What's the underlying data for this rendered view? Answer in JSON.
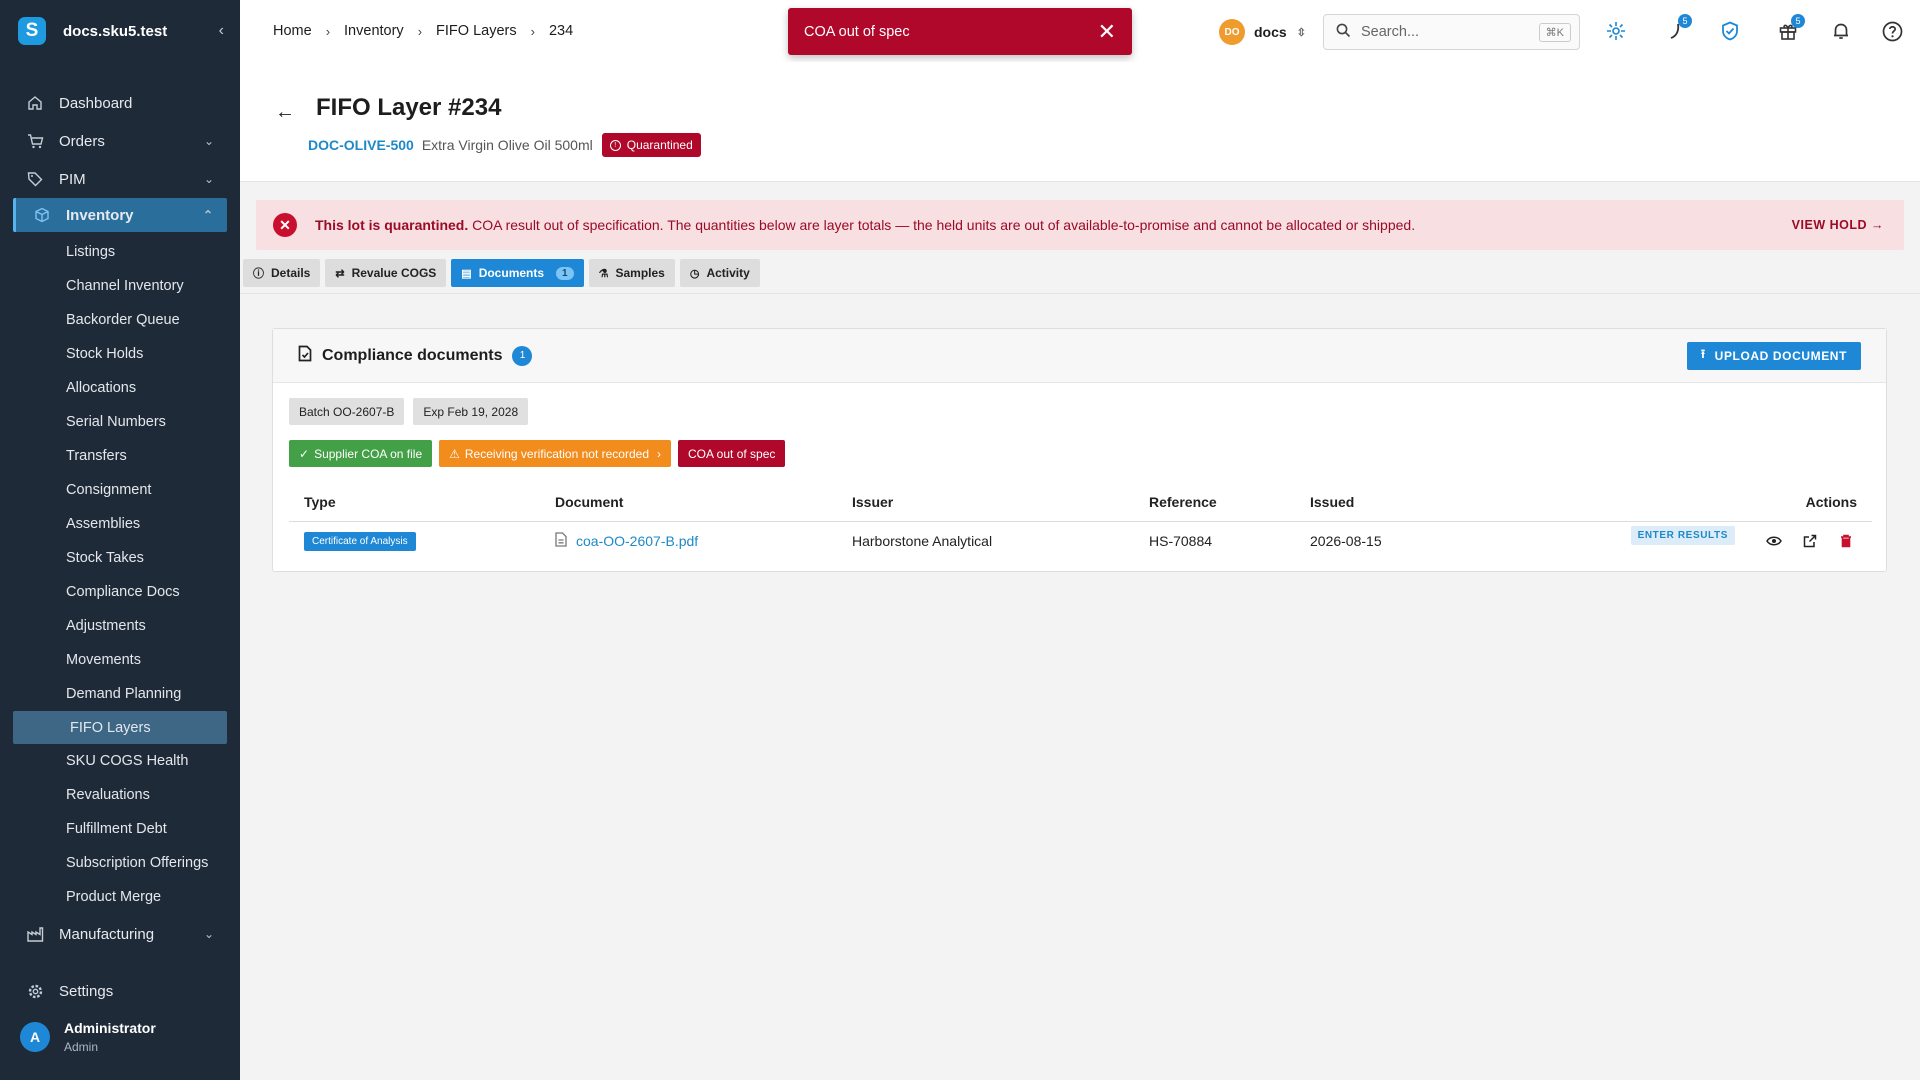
{
  "sidebar": {
    "org_name": "docs.sku5.test",
    "logo_letter": "S",
    "items": [
      {
        "label": "Dashboard"
      },
      {
        "label": "Orders"
      },
      {
        "label": "PIM"
      },
      {
        "label": "Inventory"
      }
    ],
    "inventory_sub": [
      "Listings",
      "Channel Inventory",
      "Backorder Queue",
      "Stock Holds",
      "Allocations",
      "Serial Numbers",
      "Transfers",
      "Consignment",
      "Assemblies",
      "Stock Takes",
      "Compliance Docs",
      "Adjustments",
      "Movements",
      "Demand Planning",
      "FIFO Layers",
      "SKU COGS Health",
      "Revaluations",
      "Fulfillment Debt",
      "Subscription Offerings",
      "Product Merge"
    ],
    "manufacturing": "Manufacturing",
    "settings": "Settings",
    "user": {
      "initial": "A",
      "name": "Administrator",
      "role": "Admin"
    }
  },
  "topbar": {
    "breadcrumbs": [
      "Home",
      "Inventory",
      "FIFO Layers",
      "234"
    ],
    "toast": "COA out of spec",
    "org_switch": {
      "initials": "DO",
      "name": "docs"
    },
    "search_placeholder": "Search...",
    "search_kbd": "⌘K",
    "badges": {
      "activity": "5",
      "gifts": "5"
    }
  },
  "header": {
    "title": "FIFO Layer #234",
    "sku": "DOC-OLIVE-500",
    "product": "Extra Virgin Olive Oil 500ml",
    "status": "Quarantined"
  },
  "alert": {
    "strong": "This lot is quarantined.",
    "text": " COA result out of specification. The quantities below are layer totals — the held units are out of available-to-promise and cannot be allocated or shipped.",
    "action": "VIEW HOLD"
  },
  "tabs": [
    {
      "label": "Details"
    },
    {
      "label": "Revalue COGS"
    },
    {
      "label": "Documents",
      "count": "1"
    },
    {
      "label": "Samples"
    },
    {
      "label": "Activity"
    }
  ],
  "card": {
    "title": "Compliance documents",
    "count": "1",
    "upload_label": "UPLOAD DOCUMENT",
    "chips": [
      "Batch OO-2607-B",
      "Exp Feb 19, 2028"
    ],
    "status_pills": {
      "supplier": "Supplier COA on file",
      "receiving": "Receiving verification not recorded",
      "spec": "COA out of spec"
    },
    "columns": [
      "Type",
      "Document",
      "Issuer",
      "Reference",
      "Issued",
      "Actions"
    ],
    "rows": [
      {
        "type": "Certificate of Analysis",
        "document": "coa-OO-2607-B.pdf",
        "issuer": "Harborstone Analytical",
        "reference": "HS-70884",
        "issued": "2026-08-15",
        "enter_label": "ENTER RESULTS"
      }
    ]
  },
  "colors": {
    "sidebar_bg": "#1f2a38",
    "accent": "#1e88d6",
    "danger": "#b0082a",
    "warning": "#f28c1c",
    "success": "#43a047"
  }
}
